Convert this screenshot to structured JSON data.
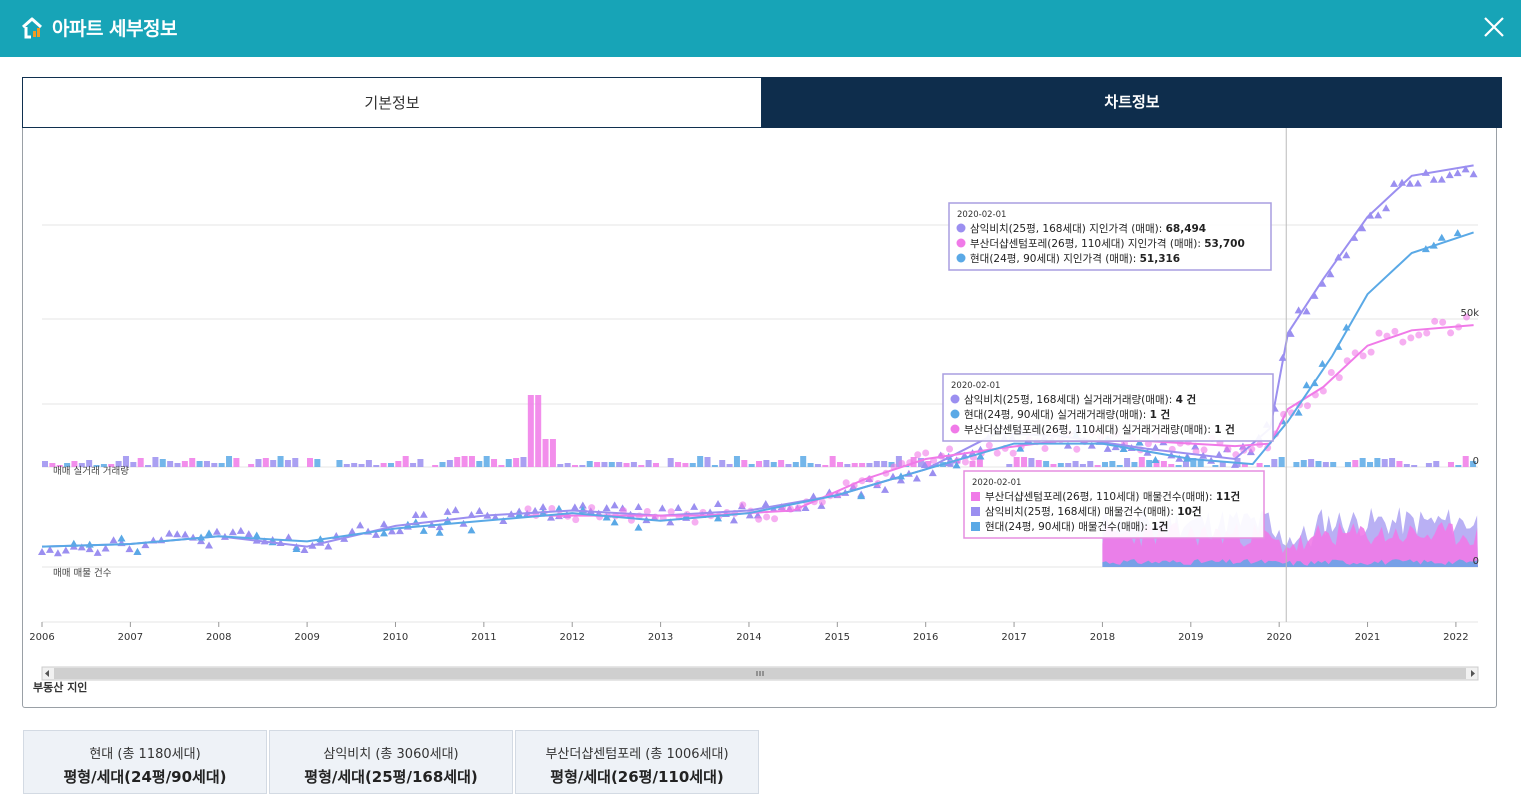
{
  "window": {
    "title": "아파트 세부정보"
  },
  "tabs": [
    {
      "label": "기본정보"
    },
    {
      "label": "차트정보"
    }
  ],
  "colors": {
    "titlebar": "#17a4b7",
    "tab_active": "#0e2d4c",
    "samik": "#9b8ff0",
    "busan": "#f07ae8",
    "hyundai": "#5aa9e6"
  },
  "chart_data": {
    "type": "line",
    "panels": [
      "price",
      "volume",
      "listings"
    ],
    "x_ticks": [
      "2006",
      "2007",
      "2008",
      "2009",
      "2010",
      "2011",
      "2012",
      "2013",
      "2014",
      "2015",
      "2016",
      "2017",
      "2018",
      "2019",
      "2020",
      "2021",
      "2022"
    ],
    "price_axis_ticks": [
      "50k",
      "0"
    ],
    "listing_axis_ticks": [
      "0"
    ],
    "panel_labels": {
      "volume": "매매 실거래 거래량",
      "listings": "매매 매물 건수"
    },
    "cursor_date": "2020-02-01",
    "series": [
      {
        "name": "삼익비치(25평, 168세대) 지인가격 (매매)",
        "color": "#9b8ff0",
        "x": [
          2006.0,
          2007.0,
          2008.0,
          2009.0,
          2010.0,
          2011.0,
          2012.0,
          2013.0,
          2014.0,
          2015.0,
          2016.0,
          2016.8,
          2017.5,
          2018.5,
          2019.5,
          2019.9,
          2020.1,
          2020.5,
          2021.0,
          2021.5,
          2022.2
        ],
        "y": [
          27000,
          27500,
          29000,
          27000,
          31000,
          33000,
          34000,
          33000,
          34000,
          37000,
          42000,
          49000,
          48500,
          46000,
          44000,
          50000,
          68494,
          79000,
          91000,
          99000,
          101000
        ]
      },
      {
        "name": "부산더샵센텀포레(26평, 110세대) 지인가격 (매매)",
        "color": "#f07ae8",
        "x": [
          2011.5,
          2012.5,
          2013.5,
          2014.5,
          2015.3,
          2016.0,
          2016.8,
          2017.5,
          2018.5,
          2019.5,
          2019.9,
          2020.1,
          2020.5,
          2021.0,
          2021.5,
          2022.2
        ],
        "y": [
          33000,
          33000,
          33000,
          34000,
          40000,
          44000,
          46000,
          47500,
          47500,
          46500,
          47000,
          53700,
          58000,
          66000,
          69000,
          70000
        ]
      },
      {
        "name": "현대(24평, 90세대) 지인가격 (매매)",
        "color": "#5aa9e6",
        "x": [
          2006.0,
          2007.0,
          2008.0,
          2009.0,
          2010.0,
          2011.0,
          2012.0,
          2013.0,
          2014.0,
          2015.0,
          2016.0,
          2017.0,
          2018.0,
          2019.0,
          2019.7,
          2020.1,
          2020.6,
          2021.0,
          2021.5,
          2022.2
        ],
        "y": [
          27000,
          27500,
          29000,
          28000,
          30500,
          32000,
          33500,
          32000,
          33500,
          37000,
          42000,
          47000,
          47000,
          44000,
          43000,
          51316,
          64000,
          76000,
          84000,
          88000
        ]
      }
    ],
    "volume_series": [
      {
        "name": "삼익비치(25평, 168세대) 실거래거래량(매매)",
        "value_at_cursor": 4
      },
      {
        "name": "현대(24평, 90세대) 실거래거래량(매매)",
        "value_at_cursor": 1
      },
      {
        "name": "부산더샵센텀포레(26평, 110세대) 실거래거래량(매매)",
        "value_at_cursor": 1
      }
    ],
    "listing_series": [
      {
        "name": "부산더샵센텀포레(26평, 110세대) 매물건수(매매)",
        "value_at_cursor": 11
      },
      {
        "name": "삼익비치(25평, 168세대) 매물건수(매매)",
        "value_at_cursor": 10
      },
      {
        "name": "현대(24평, 90세대) 매물건수(매매)",
        "value_at_cursor": 1
      }
    ]
  },
  "tooltips": {
    "price": {
      "date": "2020-02-01",
      "rows": [
        {
          "label": "삼익비치(25평, 168세대) 지인가격 (매매): ",
          "value": "68,494",
          "color": "#9b8ff0"
        },
        {
          "label": "부산더샵센텀포레(26평, 110세대) 지인가격 (매매): ",
          "value": "53,700",
          "color": "#f07ae8"
        },
        {
          "label": "현대(24평, 90세대) 지인가격 (매매): ",
          "value": "51,316",
          "color": "#5aa9e6"
        }
      ]
    },
    "volume": {
      "date": "2020-02-01",
      "rows": [
        {
          "label": "삼익비치(25평, 168세대) 실거래거래량(매매): ",
          "value": "4 건",
          "color": "#9b8ff0"
        },
        {
          "label": "현대(24평, 90세대) 실거래거래량(매매): ",
          "value": "1 건",
          "color": "#5aa9e6"
        },
        {
          "label": "부산더샵센텀포레(26평, 110세대) 실거래거래량(매매): ",
          "value": "1 건",
          "color": "#f07ae8"
        }
      ]
    },
    "listing": {
      "date": "2020-02-01",
      "rows": [
        {
          "label": "부산더샵센텀포레(26평, 110세대) 매물건수(매매): ",
          "value": "11건",
          "color": "#f07ae8"
        },
        {
          "label": "삼익비치(25평, 168세대) 매물건수(매매): ",
          "value": "10건",
          "color": "#9b8ff0"
        },
        {
          "label": "현대(24평, 90세대) 매물건수(매매): ",
          "value": "1건",
          "color": "#5aa9e6"
        }
      ]
    }
  },
  "watermark": "부동산 지인",
  "stats": [
    {
      "name": "현대 (총 1180세대)",
      "detail": "평형/세대(24평/90세대)"
    },
    {
      "name": "삼익비치 (총 3060세대)",
      "detail": "평형/세대(25평/168세대)"
    },
    {
      "name": "부산더샵센텀포레 (총 1006세대)",
      "detail": "평형/세대(26평/110세대)"
    }
  ]
}
